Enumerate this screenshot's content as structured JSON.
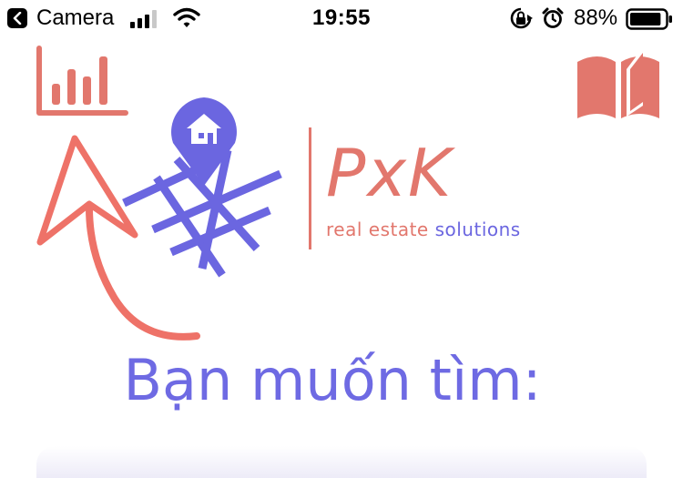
{
  "status_bar": {
    "back_label": "Camera",
    "time": "19:55",
    "battery_percent": "88%",
    "battery_level": 0.88,
    "icons": [
      "back-arrow-icon",
      "signal-icon",
      "wifi-icon",
      "rotation-lock-icon",
      "alarm-icon",
      "battery-icon"
    ]
  },
  "toolbar": {
    "left_icon": "bar-chart-icon",
    "right_icon": "book-icon"
  },
  "hint": {
    "icon": "curved-arrow-icon"
  },
  "logo": {
    "wordmark": "PxK",
    "tagline_part1": "real estate",
    "tagline_part2": "solutions",
    "icon": "map-pin-home-icon"
  },
  "main": {
    "prompt": "Bạn muốn tìm:"
  },
  "colors": {
    "coral": "#e2776d",
    "indigo": "#6b66e0"
  }
}
